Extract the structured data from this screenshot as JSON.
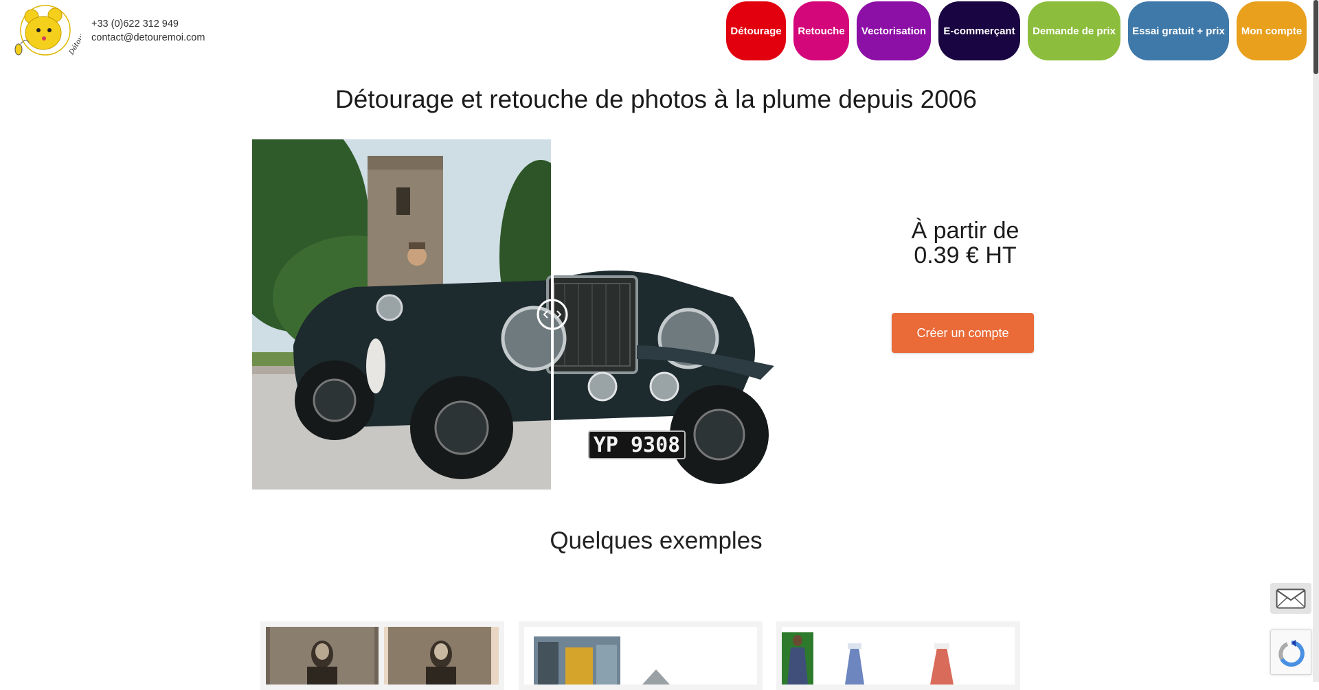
{
  "header": {
    "phone": "+33 (0)622 312 949",
    "email": "contact@detouremoi.com",
    "logo_text": "Détoure-moi"
  },
  "nav": [
    {
      "label": "Détourage",
      "color": "#e2000e"
    },
    {
      "label": "Retouche",
      "color": "#d4077a"
    },
    {
      "label": "Vectorisation",
      "color": "#8c0fa6"
    },
    {
      "label": "E-commerçant",
      "color": "#190541"
    },
    {
      "label": "Demande de prix",
      "color": "#8cbd3c"
    },
    {
      "label": "Essai gratuit + prix",
      "color": "#3f79a9"
    },
    {
      "label": "Mon compte",
      "color": "#e9a01d"
    }
  ],
  "hero": {
    "headline": "Détourage et retouche de photos à la plume depuis 2006",
    "price_line1": "À partir de",
    "price_line2": "0.39 € HT",
    "cta_label": "Créer un compte",
    "plate_text": "YP 9308"
  },
  "examples": {
    "title": "Quelques exemples"
  },
  "colors": {
    "accent": "#ea6b38"
  },
  "icons": {
    "mail": "envelope-icon",
    "slider": "slider-handle-icon"
  }
}
